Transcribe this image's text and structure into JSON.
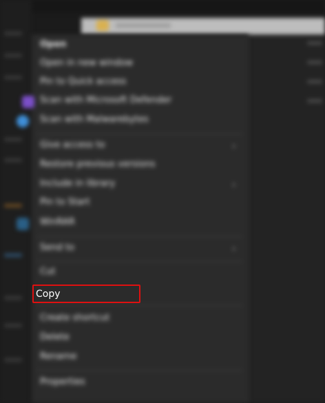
{
  "menu": {
    "items": [
      {
        "label": "Open"
      },
      {
        "label": "Open in new window"
      },
      {
        "label": "Pin to Quick access"
      },
      {
        "label": "Scan with Microsoft Defender"
      },
      {
        "label": "Scan with Malwarebytes"
      },
      {
        "label": "Give access to"
      },
      {
        "label": "Restore previous versions"
      },
      {
        "label": "Include in library"
      },
      {
        "label": "Pin to Start"
      },
      {
        "label": "WinRAR"
      },
      {
        "label": "Send to"
      },
      {
        "label": "Cut"
      },
      {
        "label": "Copy"
      },
      {
        "label": "Create shortcut"
      },
      {
        "label": "Delete"
      },
      {
        "label": "Rename"
      },
      {
        "label": "Properties"
      }
    ],
    "highlighted": "Copy"
  },
  "colors": {
    "menu_bg": "#2b2b2b",
    "highlight": "#e01010"
  }
}
